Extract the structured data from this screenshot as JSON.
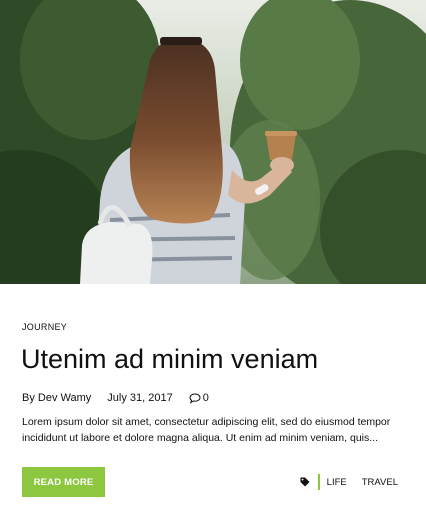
{
  "post": {
    "category": "JOURNEY",
    "title": "Utenim ad minim veniam",
    "author": "By Dev Wamy",
    "date": "July 31, 2017",
    "comment_count": "0",
    "excerpt": "Lorem ipsum dolor sit amet, consectetur adipiscing elit, sed do eiusmod tempor incididunt ut labore et dolore magna aliqua. Ut enim ad minim veniam, quis...",
    "read_more_label": "READ MORE",
    "tags": [
      "LIFE",
      "TRAVEL"
    ]
  },
  "colors": {
    "accent": "#8dc63f",
    "text": "#111111",
    "background": "#ffffff"
  },
  "icons": {
    "comment": "comment-icon",
    "tag": "tag-icon"
  }
}
